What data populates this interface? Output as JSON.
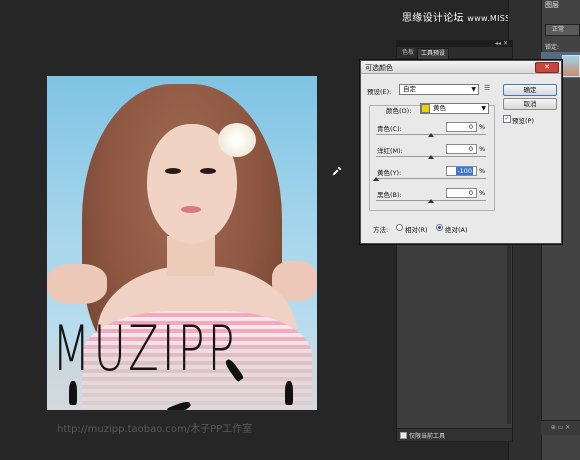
{
  "watermark": {
    "site_name": "思缘设计论坛",
    "url": "www.MISSYUAN.COM"
  },
  "layers_panel": {
    "tab": "图层",
    "blend_mode": "正常",
    "lock_label": "锁定:"
  },
  "presets_panel": {
    "tabs": [
      "色板",
      "工具预设"
    ],
    "collapse_glyph": "◂◂ ✕",
    "current_tool_only_label": "仅限当前工具"
  },
  "photo": {
    "brand_text": "MUZIPP",
    "url_text": "http://muzipp.taobao.com/木子PP工作室"
  },
  "dialog": {
    "title": "可选颜色",
    "close_glyph": "✕",
    "preset_label": "预设(E):",
    "preset_value": "自定",
    "preset_menu_icon": "menu-list-icon",
    "ok_label": "确定",
    "cancel_label": "取消",
    "preview_label": "预览(P)",
    "preview_checked": "✓",
    "colors_label": "颜色(O):",
    "colors_value": "黄色",
    "colors_swatch": "#f2cf00",
    "channels": [
      {
        "label": "青色(C):",
        "value": "0",
        "unit": "%",
        "slider_fraction": 0.5,
        "selected": false
      },
      {
        "label": "洋红(M):",
        "value": "0",
        "unit": "%",
        "slider_fraction": 0.5,
        "selected": false
      },
      {
        "label": "黄色(Y):",
        "value": "-100",
        "unit": "%",
        "slider_fraction": 0.0,
        "selected": true
      },
      {
        "label": "黑色(B):",
        "value": "0",
        "unit": "%",
        "slider_fraction": 0.5,
        "selected": false
      }
    ],
    "method_label": "方法:",
    "method_relative": "相对(R)",
    "method_absolute": "绝对(A)",
    "method_selected": "absolute"
  }
}
